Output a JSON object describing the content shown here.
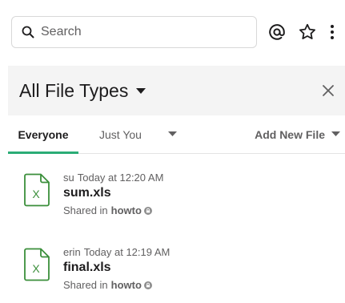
{
  "search": {
    "placeholder": "Search"
  },
  "icons": {
    "search": "search-icon",
    "mentions": "at-icon",
    "starred": "star-icon",
    "more": "vertical-ellipsis-icon",
    "close": "close-icon",
    "file": "spreadsheet-file-icon",
    "shared_channel": "lock-icon"
  },
  "panel": {
    "title": "All File Types",
    "tabs": [
      {
        "label": "Everyone",
        "active": true
      },
      {
        "label": "Just You",
        "active": false
      }
    ],
    "add_new_file": "Add New File"
  },
  "files": [
    {
      "user": "su",
      "time": "Today at 12:20 AM",
      "name": "sum.xls",
      "shared_prefix": "Shared in",
      "channel": "howto",
      "icon_letter": "X"
    },
    {
      "user": "erin",
      "time": "Today at 12:19 AM",
      "name": "final.xls",
      "shared_prefix": "Shared in",
      "channel": "howto",
      "icon_letter": "X"
    }
  ],
  "colors": {
    "accent_green": "#2bac76",
    "file_icon_green": "#3b8f3b",
    "header_bg": "#f4f4f4",
    "muted_text": "#616061"
  }
}
